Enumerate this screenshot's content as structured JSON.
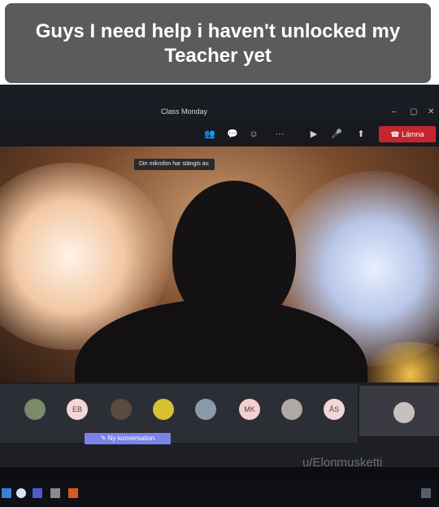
{
  "caption": {
    "line1": "Guys I need help i haven't unlocked my",
    "line2": "Teacher yet"
  },
  "window": {
    "title": "Class Monday",
    "minimize": "–",
    "maximize": "▢",
    "close": "✕"
  },
  "toolbar": {
    "leave_label": "Lämna",
    "more": "···"
  },
  "tooltip": {
    "text": "Din mikrofon har stängts av."
  },
  "participants": [
    {
      "initials": ""
    },
    {
      "initials": "EB"
    },
    {
      "initials": ""
    },
    {
      "initials": ""
    },
    {
      "initials": ""
    },
    {
      "initials": "MK"
    },
    {
      "initials": ""
    },
    {
      "initials": "ÅS"
    }
  ],
  "chat": {
    "new_conversation": "Ny konversation"
  },
  "watermark": {
    "text": "u/Elonmusketti"
  },
  "colors": {
    "leave": "#c4262e",
    "accent": "#7b83eb"
  }
}
